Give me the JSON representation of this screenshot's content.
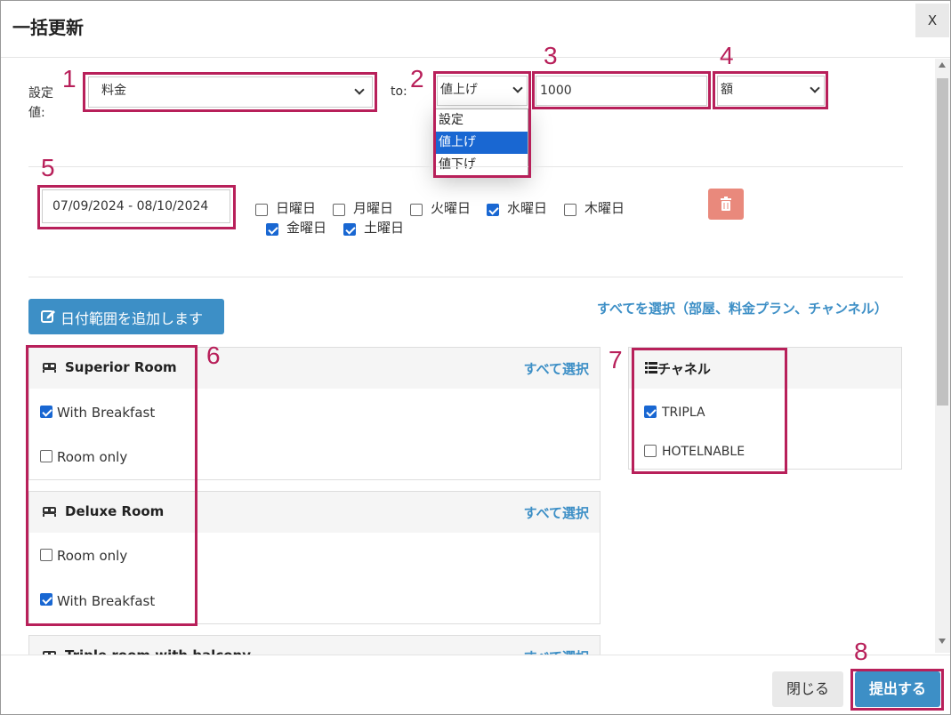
{
  "modal": {
    "title": "一括更新",
    "close_label": "X"
  },
  "setting": {
    "label": "設定値:",
    "field_value": "料金",
    "to_label": "to:",
    "direction_value": "値上げ",
    "direction_options": [
      "設定",
      "値上げ",
      "値下げ"
    ],
    "amount_value": "1000",
    "unit_value": "額"
  },
  "date_range": {
    "value": "07/09/2024 - 08/10/2024",
    "weekdays": [
      {
        "label": "日曜日",
        "checked": false
      },
      {
        "label": "月曜日",
        "checked": false
      },
      {
        "label": "火曜日",
        "checked": false
      },
      {
        "label": "水曜日",
        "checked": true
      },
      {
        "label": "木曜日",
        "checked": false
      },
      {
        "label": "金曜日",
        "checked": true
      },
      {
        "label": "土曜日",
        "checked": true
      }
    ]
  },
  "add_range_label": "日付範囲を追加します",
  "select_all_label": "すべてを選択（部屋、料金プラン、チャンネル）",
  "rooms": [
    {
      "name": "Superior Room",
      "select_label": "すべて選択",
      "plans": [
        {
          "label": "With Breakfast",
          "checked": true
        },
        {
          "label": "Room only",
          "checked": false
        }
      ]
    },
    {
      "name": "Deluxe Room",
      "select_label": "すべて選択",
      "plans": [
        {
          "label": "Room only",
          "checked": false
        },
        {
          "label": "With Breakfast",
          "checked": true
        }
      ]
    },
    {
      "name": "Triple room with balcony",
      "select_label": "すべて選択",
      "plans": []
    }
  ],
  "channels": {
    "title": "チャネル",
    "items": [
      {
        "label": "TRIPLA",
        "checked": true
      },
      {
        "label": "HOTELNABLE",
        "checked": false
      }
    ]
  },
  "footer": {
    "close_label": "閉じる",
    "submit_label": "提出する"
  },
  "annotations": [
    "1",
    "2",
    "3",
    "4",
    "5",
    "6",
    "7",
    "8"
  ],
  "colors": {
    "annotation": "#b8205a",
    "primary": "#3d8fc6",
    "danger": "#e9897c",
    "selected": "#1967d2"
  }
}
